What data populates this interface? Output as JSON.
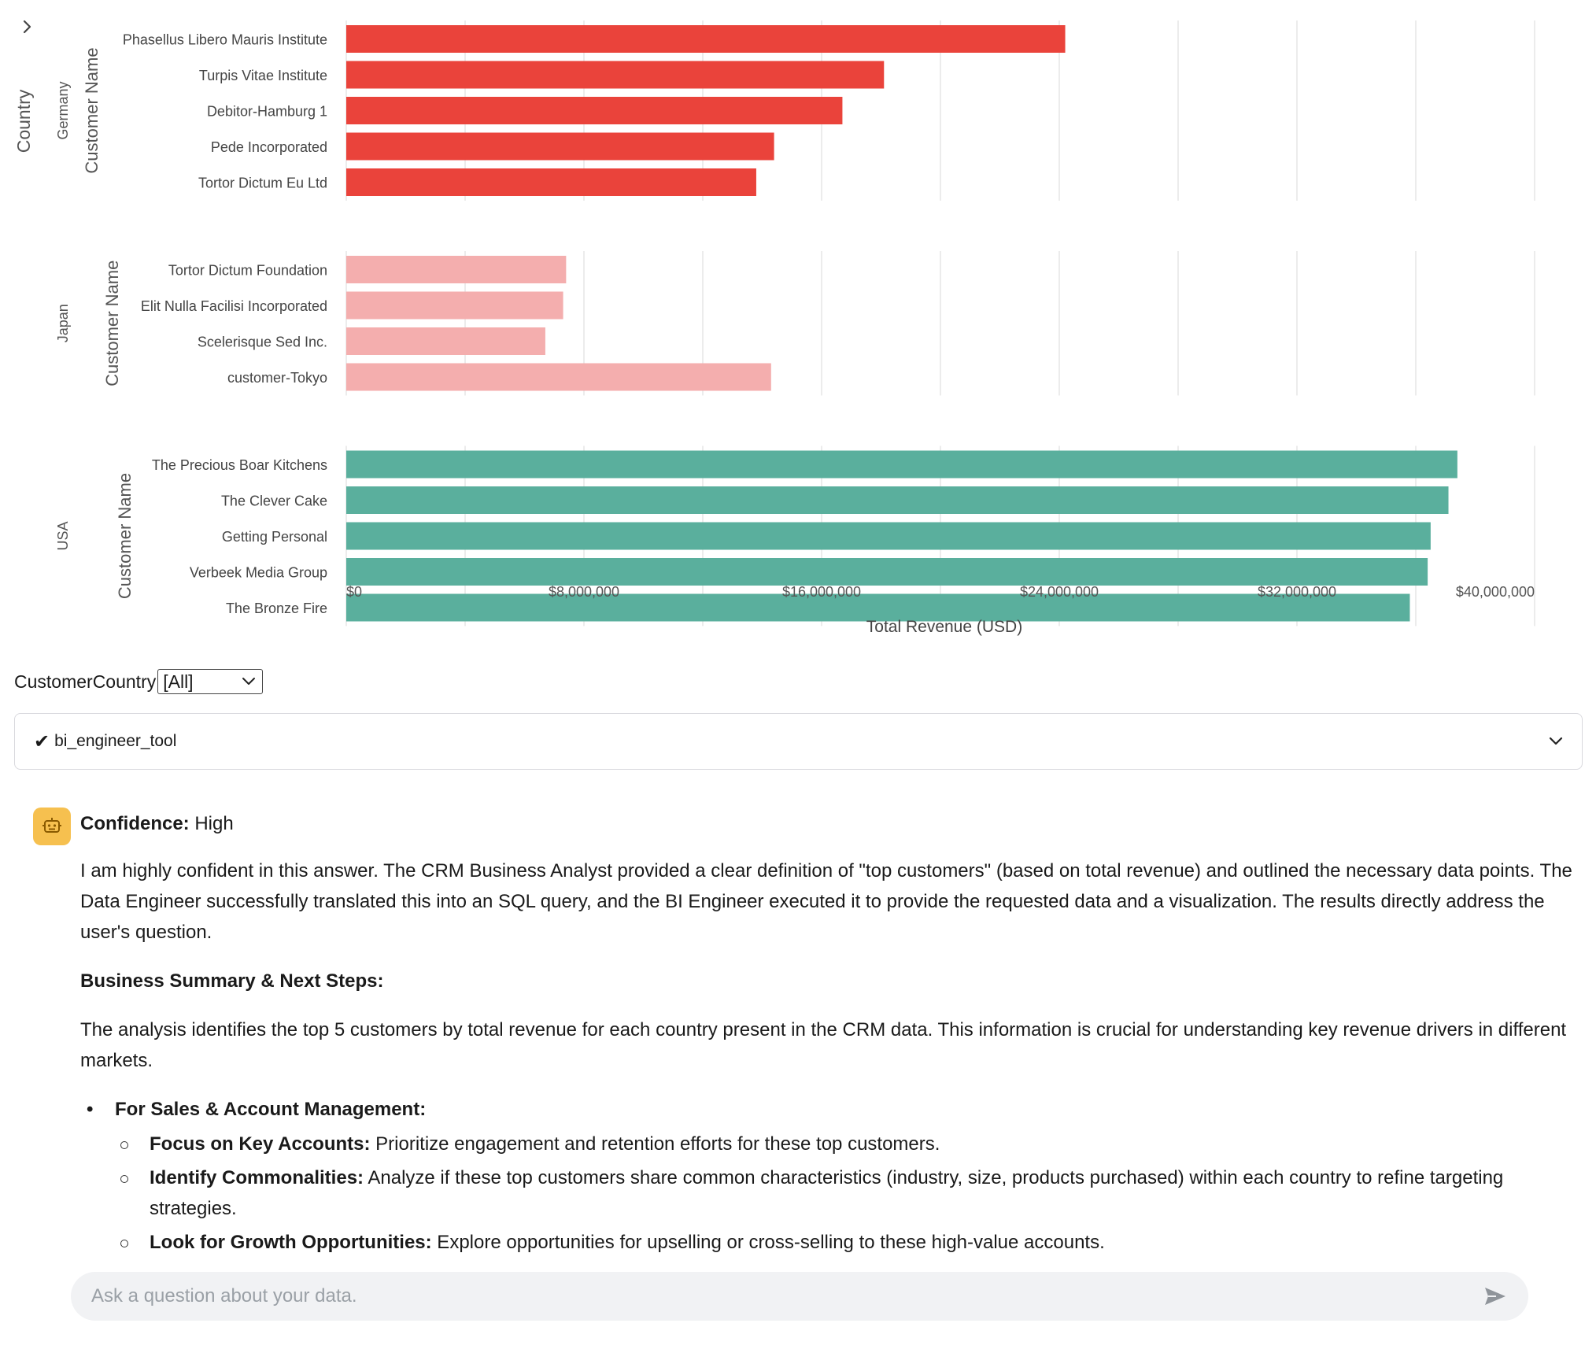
{
  "chart_data": {
    "type": "bar",
    "orientation": "horizontal",
    "xlabel": "Total Revenue (USD)",
    "x_ticks": [
      "$0",
      "$8,000,000",
      "$16,000,000",
      "$24,000,000",
      "$32,000,000",
      "$40,000,000"
    ],
    "xlim": [
      0,
      40000000
    ],
    "outer_row_label": "Country",
    "inner_row_label": "Customer Name",
    "grid": "vertical",
    "groups": [
      {
        "country": "Germany",
        "color": "#ea433b",
        "customers": [
          "Phasellus Libero Mauris Institute",
          "Turpis Vitae Institute",
          "Debitor-Hamburg 1",
          "Pede Incorporated",
          "Tortor Dictum Eu Ltd"
        ],
        "values": [
          24200000,
          18100000,
          16700000,
          14400000,
          13800000
        ]
      },
      {
        "country": "Japan",
        "color": "#f4aeae",
        "customers": [
          "Tortor Dictum Foundation",
          "Elit Nulla Facilisi Incorporated",
          "Scelerisque Sed Inc.",
          "customer-Tokyo"
        ],
        "values": [
          7400000,
          7300000,
          6700000,
          14300000
        ]
      },
      {
        "country": "USA",
        "color": "#5aaf9d",
        "customers": [
          "The Precious Boar Kitchens",
          "The Clever Cake",
          "Getting Personal",
          "Verbeek Media Group",
          "The Bronze Fire"
        ],
        "values": [
          37400000,
          37100000,
          36500000,
          36400000,
          35800000
        ]
      }
    ]
  },
  "filter": {
    "label": "CustomerCountry",
    "value": "[All]"
  },
  "tool": {
    "check": "✔",
    "name": "bi_engineer_tool"
  },
  "message": {
    "confidence_label": "Confidence:",
    "confidence_value": " High",
    "paragraph1": "I am highly confident in this answer. The CRM Business Analyst provided a clear definition of \"top customers\" (based on total revenue) and outlined the necessary data points. The Data Engineer successfully translated this into an SQL query, and the BI Engineer executed it to provide the requested data and a visualization. The results directly address the user's question.",
    "summary_heading": "Business Summary & Next Steps:",
    "paragraph2": "The analysis identifies the top 5 customers by total revenue for each country present in the CRM data. This information is crucial for understanding key revenue drivers in different markets.",
    "section_heading": "For Sales & Account Management:",
    "bullets": [
      {
        "title": "Focus on Key Accounts:",
        "text": " Prioritize engagement and retention efforts for these top customers."
      },
      {
        "title": "Identify Commonalities:",
        "text": " Analyze if these top customers share common characteristics (industry, size, products purchased) within each country to refine targeting strategies."
      },
      {
        "title": "Look for Growth Opportunities:",
        "text": " Explore opportunities for upselling or cross-selling to these high-value accounts."
      }
    ]
  },
  "chat": {
    "placeholder": "Ask a question about your data."
  },
  "colors": {
    "avatar": "#f6c04f",
    "input_bg": "#f1f2f4"
  },
  "icons": {
    "expand": "chevron-right-icon",
    "dropdown": "chevron-down-icon",
    "avatar": "robot-icon",
    "send": "send-icon"
  }
}
